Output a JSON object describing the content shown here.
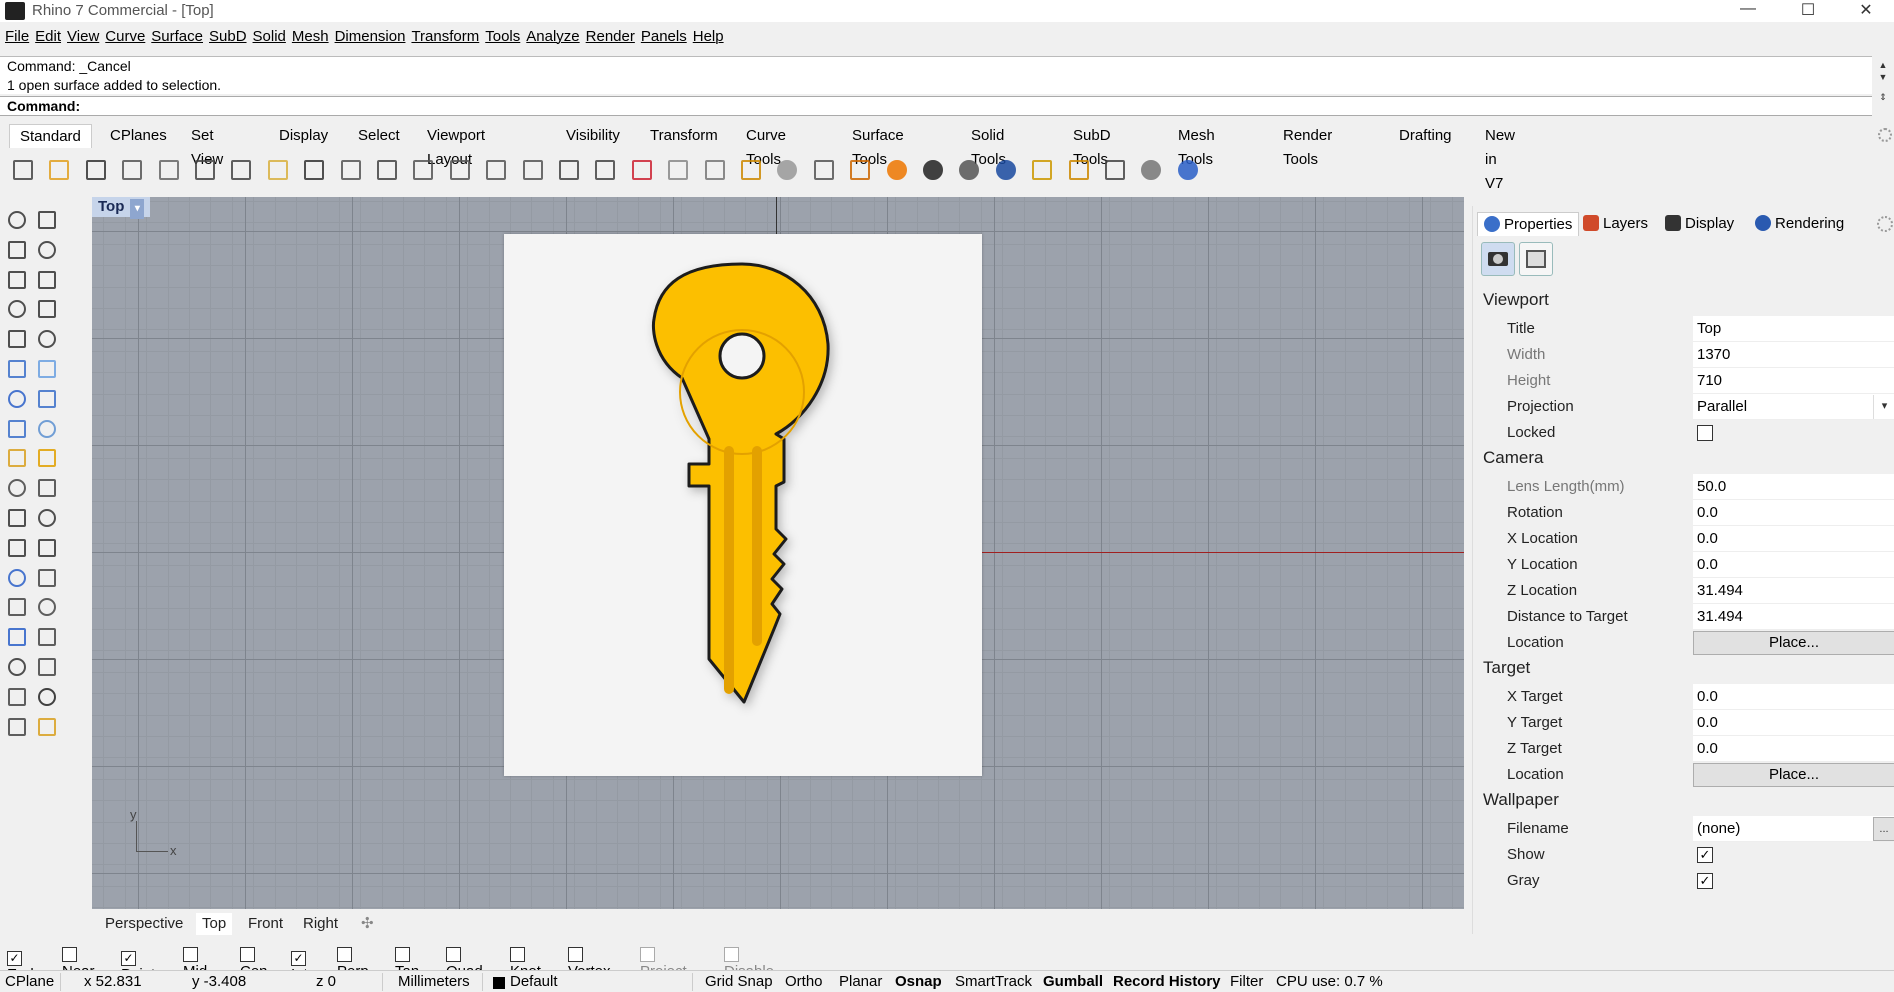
{
  "window": {
    "title": "Rhino 7 Commercial - [Top]",
    "minimize_glyph": "—",
    "maximize_glyph": "☐",
    "close_glyph": "✕"
  },
  "menu": [
    "File",
    "Edit",
    "View",
    "Curve",
    "Surface",
    "SubD",
    "Solid",
    "Mesh",
    "Dimension",
    "Transform",
    "Tools",
    "Analyze",
    "Render",
    "Panels",
    "Help"
  ],
  "command": {
    "history": [
      "Command: _Cancel",
      "1 open surface added to selection."
    ],
    "prompt": "Command:"
  },
  "toolbar_tabs": [
    "Standard",
    "CPlanes",
    "Set View",
    "Display",
    "Select",
    "Viewport Layout",
    "Visibility",
    "Transform",
    "Curve Tools",
    "Surface Tools",
    "Solid Tools",
    "SubD Tools",
    "Mesh Tools",
    "Render Tools",
    "Drafting",
    "New in V7"
  ],
  "toolbar_icons": [
    "new-icon",
    "open-icon",
    "save-icon",
    "print-icon",
    "import-icon",
    "cut-icon",
    "copy-icon",
    "paste-icon",
    "undo-icon",
    "pan-icon",
    "rotate-view-icon",
    "zoom-icon",
    "zoom-window-icon",
    "zoom-extents-icon",
    "zoom-selected-icon",
    "rotate-icon",
    "four-viewports-icon",
    "car-icon",
    "grid-icon",
    "osnap-icon",
    "points-icon",
    "light-icon",
    "lock-icon",
    "layer-icon",
    "color-wheel-icon",
    "sphere-wireframe-icon",
    "sphere-shaded-icon",
    "sphere-rendered-icon",
    "filter-icon",
    "settings-gear-icon",
    "dimension-icon",
    "render-icon",
    "help-icon"
  ],
  "viewport": {
    "label": "Top",
    "dropdown_glyph": "▾",
    "axis_y": "y",
    "axis_x": "x"
  },
  "viewport_tabs": [
    "Perspective",
    "Top",
    "Front",
    "Right"
  ],
  "viewport_tabs_add": "✣",
  "panel": {
    "tabs": [
      "Properties",
      "Layers",
      "Display",
      "Rendering"
    ],
    "sections": {
      "viewport": "Viewport",
      "camera": "Camera",
      "target": "Target",
      "wallpaper": "Wallpaper"
    },
    "viewport_rows": [
      {
        "label": "Title",
        "value": "Top"
      },
      {
        "label": "Width",
        "value": "1370"
      },
      {
        "label": "Height",
        "value": "710"
      },
      {
        "label": "Projection",
        "value": "Parallel"
      },
      {
        "label": "Locked",
        "value": ""
      }
    ],
    "camera_rows": [
      {
        "label": "Lens Length(mm)",
        "value": "50.0"
      },
      {
        "label": "Rotation",
        "value": "0.0"
      },
      {
        "label": "X Location",
        "value": "0.0"
      },
      {
        "label": "Y Location",
        "value": "0.0"
      },
      {
        "label": "Z Location",
        "value": "31.494"
      },
      {
        "label": "Distance to Target",
        "value": "31.494"
      },
      {
        "label": "Location",
        "value": "Place..."
      }
    ],
    "target_rows": [
      {
        "label": "X Target",
        "value": "0.0"
      },
      {
        "label": "Y Target",
        "value": "0.0"
      },
      {
        "label": "Z Target",
        "value": "0.0"
      },
      {
        "label": "Location",
        "value": "Place..."
      }
    ],
    "wallpaper_rows": [
      {
        "label": "Filename",
        "value": "(none)"
      },
      {
        "label": "Show",
        "value": "✓"
      },
      {
        "label": "Gray",
        "value": "✓"
      }
    ],
    "filename_button": "..."
  },
  "osnaps": [
    {
      "label": "End",
      "checked": true
    },
    {
      "label": "Near",
      "checked": false
    },
    {
      "label": "Point",
      "checked": true
    },
    {
      "label": "Mid",
      "checked": false
    },
    {
      "label": "Cen",
      "checked": false
    },
    {
      "label": "Int",
      "checked": true
    },
    {
      "label": "Perp",
      "checked": false
    },
    {
      "label": "Tan",
      "checked": false
    },
    {
      "label": "Quad",
      "checked": false
    },
    {
      "label": "Knot",
      "checked": false
    },
    {
      "label": "Vertex",
      "checked": false
    },
    {
      "label": "Project",
      "checked": false,
      "disabled": true
    },
    {
      "label": "Disable",
      "checked": false,
      "disabled": true
    }
  ],
  "check_glyph": "✓",
  "status": {
    "cplane": "CPlane",
    "x": "x 52.831",
    "y": "y -3.408",
    "z": "z 0",
    "units": "Millimeters",
    "layer": "Default",
    "grid_snap": "Grid Snap",
    "ortho": "Ortho",
    "planar": "Planar",
    "osnap": "Osnap",
    "smarttrack": "SmartTrack",
    "gumball": "Gumball",
    "record_history": "Record History",
    "filter": "Filter",
    "cpu": "CPU use: 0.7 %"
  },
  "colors": {
    "key_fill": "#fcbf00",
    "key_shadow": "#e3a100",
    "viewport_bg": "#9ca2ac"
  }
}
